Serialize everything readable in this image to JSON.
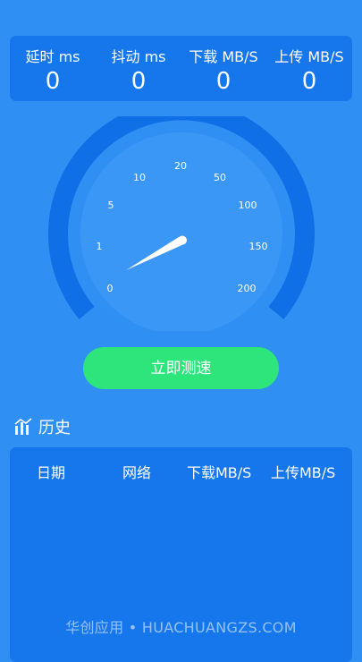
{
  "stats": [
    {
      "label": "延时 ms",
      "value": "0"
    },
    {
      "label": "抖动 ms",
      "value": "0"
    },
    {
      "label": "下载 MB/S",
      "value": "0"
    },
    {
      "label": "上传 MB/S",
      "value": "0"
    }
  ],
  "gauge": {
    "ticks": [
      "0",
      "1",
      "5",
      "10",
      "20",
      "50",
      "100",
      "150",
      "200"
    ],
    "needle_value": "0",
    "colors": {
      "outer_arc": "#0f6fe6",
      "dial": "#3a97f5",
      "needle": "#ffffff"
    }
  },
  "actions": {
    "test_button_label": "立即测速"
  },
  "history": {
    "title": "历史",
    "columns": [
      "日期",
      "网络",
      "下载MB/S",
      "上传MB/S"
    ],
    "rows": []
  },
  "watermark": "华创应用 • HUACHUANGZS.COM",
  "colors": {
    "background": "#2f8ff3",
    "panel": "#1577eb",
    "accent_button": "#2ee57c"
  }
}
